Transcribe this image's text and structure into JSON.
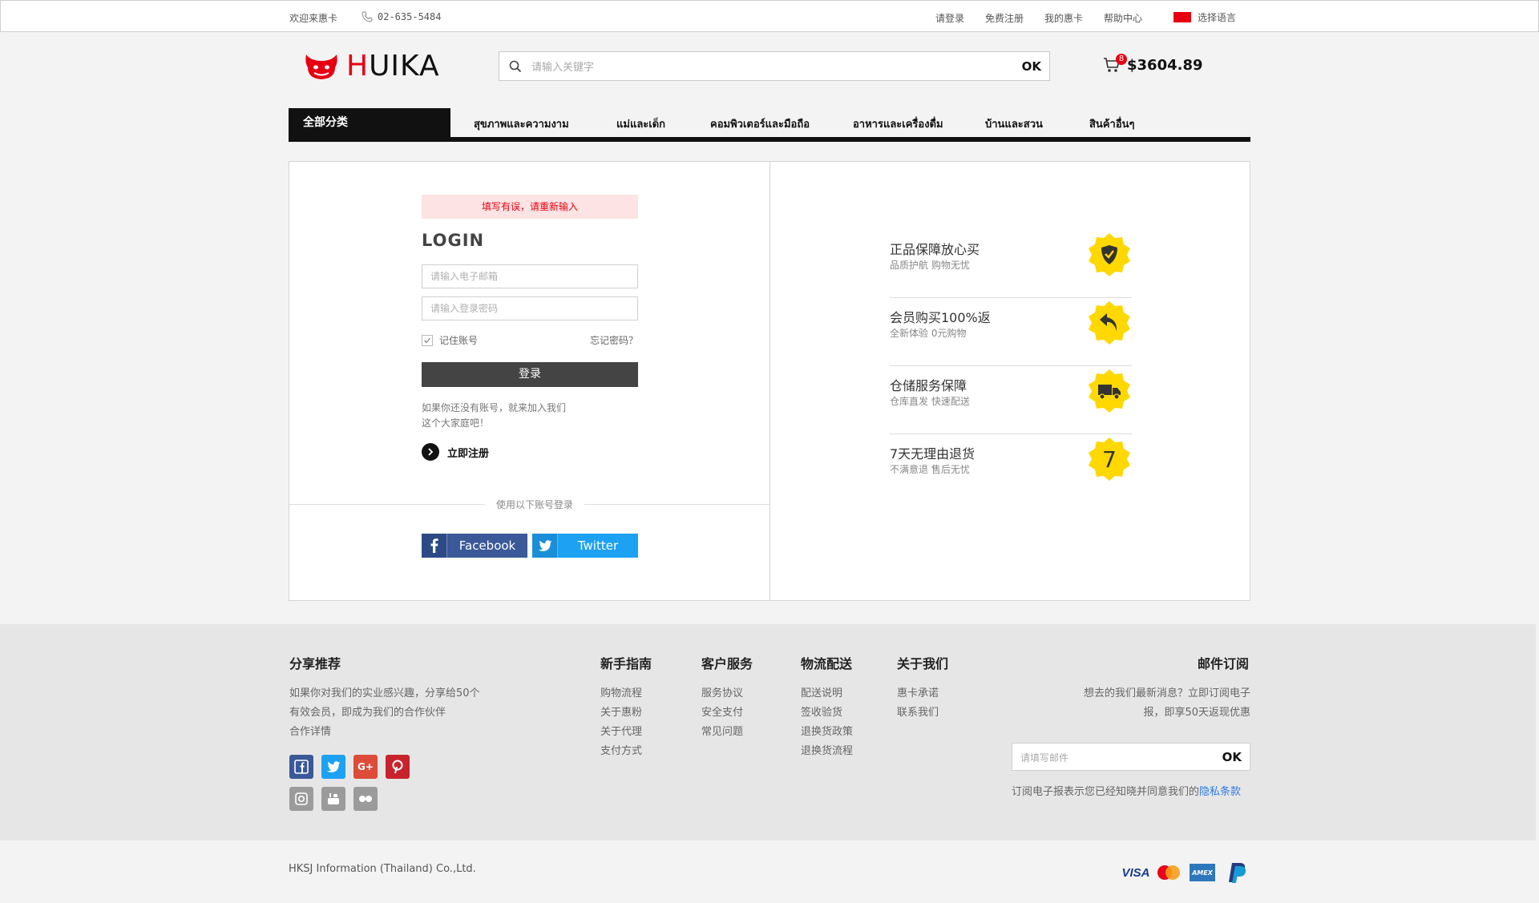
{
  "topbar": {
    "welcome": "欢迎来惠卡",
    "phone": "02-635-5484",
    "links": [
      "请登录",
      "免费注册",
      "我的惠卡",
      "帮助中心"
    ],
    "language": "选择语言"
  },
  "header": {
    "logo_text_red": "H",
    "logo_text": "UIKA",
    "search_placeholder": "请输入关键字",
    "search_button": "OK",
    "cart_count": "8",
    "cart_amount": "$3604.89"
  },
  "nav": {
    "all_categories": "全部分类",
    "items": [
      "สุขภาพและความงาม",
      "แม่และเด็ก",
      "คอมพิวเตอร์และมือถือ",
      "อาหารและเครื่องดื่ม",
      "บ้านและสวน",
      "สินค้าอื่นๆ"
    ]
  },
  "login": {
    "error": "填写有误，请重新输入",
    "title": "LOGIN",
    "email_placeholder": "请输入电子邮箱",
    "password_placeholder": "请输入登录密码",
    "remember_label": "记住账号",
    "forgot": "忘记密码？",
    "submit": "登录",
    "invite_line1": "如果你还没有账号，就来加入我们",
    "invite_line2": "这个大家庭吧！",
    "register": "立即注册",
    "alt_label": "使用以下账号登录",
    "facebook": "Facebook",
    "twitter": "Twitter"
  },
  "features": [
    {
      "title": "正品保障放心买",
      "sub": "品质护航 购物无忧",
      "icon": "shield-check-icon"
    },
    {
      "title": "会员购买100%返",
      "sub": "全新体验 0元购物",
      "icon": "return-arrow-icon"
    },
    {
      "title": "仓储服务保障",
      "sub": "仓库直发 快速配送",
      "icon": "truck-icon"
    },
    {
      "title": "7天无理由退货",
      "sub": "不满意退 售后无忧",
      "icon": "seven-days-icon",
      "badge_text": "7"
    }
  ],
  "footer": {
    "share": {
      "title": "分享推荐",
      "line1": "如果你对我们的实业感兴趣，分享给50个",
      "line2": "有效会员，即成为我们的合作伙伴",
      "line3": "合作详情"
    },
    "columns": [
      {
        "title": "新手指南",
        "links": [
          "购物流程",
          "关于惠粉",
          "关于代理",
          "支付方式"
        ]
      },
      {
        "title": "客户服务",
        "links": [
          "服务协议",
          "安全支付",
          "常见问题"
        ]
      },
      {
        "title": "物流配送",
        "links": [
          "配送说明",
          "签收验货",
          "退换货政策",
          "退换货流程"
        ]
      },
      {
        "title": "关于我们",
        "links": [
          "惠卡承诺",
          "联系我们"
        ]
      }
    ],
    "newsletter": {
      "title": "邮件订阅",
      "line1": "想去的我们最新消息？立即订阅电子",
      "line2": "报，即享50天返现优惠",
      "placeholder": "请填写邮件",
      "button": "OK",
      "terms_prefix": "订阅电子报表示您已经知晓并同意我们的",
      "terms_link": "隐私条款"
    },
    "social_icons": [
      "facebook-icon",
      "twitter-icon",
      "google-plus-icon",
      "pinterest-icon",
      "instagram-icon",
      "youtube-icon",
      "flickr-icon"
    ],
    "google_plus_text": "G+"
  },
  "bottom": {
    "copyright": "HKSJ Information (Thailand) Co.,Ltd.",
    "payments": [
      "VISA",
      "mastercard-icon",
      "AMEX",
      "paypal-icon"
    ]
  },
  "colors": {
    "brand_red": "#e60012",
    "badge_yellow": "#ffd800",
    "facebook": "#3b5998",
    "twitter": "#1da1f2"
  }
}
